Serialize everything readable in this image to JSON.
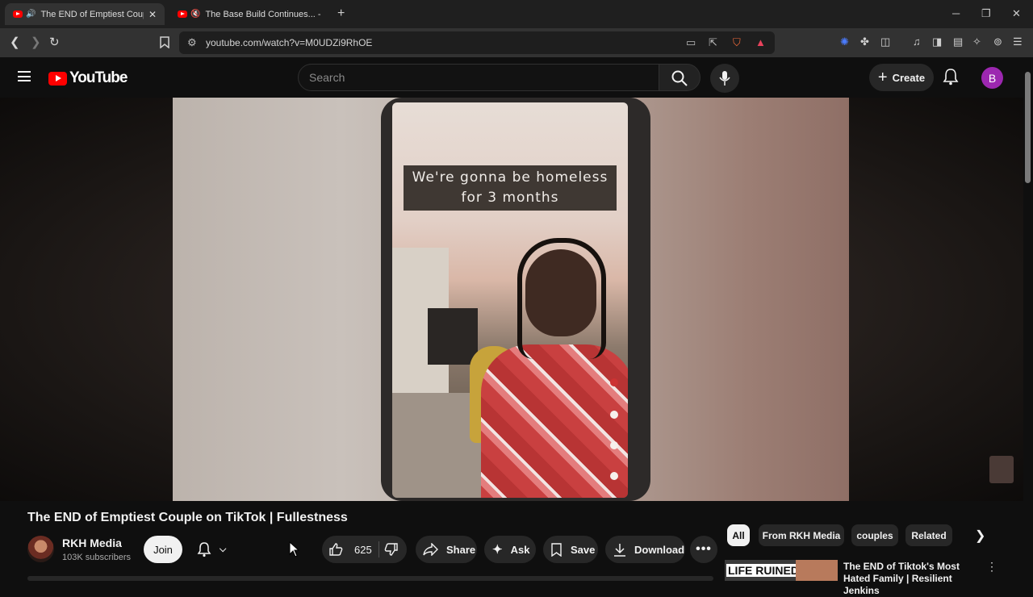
{
  "browser": {
    "tabs": [
      {
        "title": "The END of Emptiest Couple o",
        "audio": "playing"
      },
      {
        "title": "The Base Build Continues... - You",
        "audio": "muted"
      }
    ],
    "url": "youtube.com/watch?v=M0UDZi9RhOE"
  },
  "youtube": {
    "logo_text": "YouTube",
    "search_placeholder": "Search",
    "create_label": "Create",
    "avatar_letter": "B",
    "accent": "#ff0000",
    "avatar_color": "#9c27b0"
  },
  "video": {
    "caption": "We're gonna be homeless for 3 months",
    "title": "The END of Emptiest Couple on TikTok | Fullestness",
    "channel_name": "RKH Media",
    "subscribers": "103K subscribers",
    "join_label": "Join",
    "like_count": "625",
    "share_label": "Share",
    "ask_label": "Ask",
    "save_label": "Save",
    "download_label": "Download"
  },
  "chips": [
    "All",
    "From RKH Media",
    "couples",
    "Related"
  ],
  "recommendation": {
    "thumb_text": "LIFE RUINED",
    "title": "The END of Tiktok's Most Hated Family | Resilient Jenkins"
  }
}
